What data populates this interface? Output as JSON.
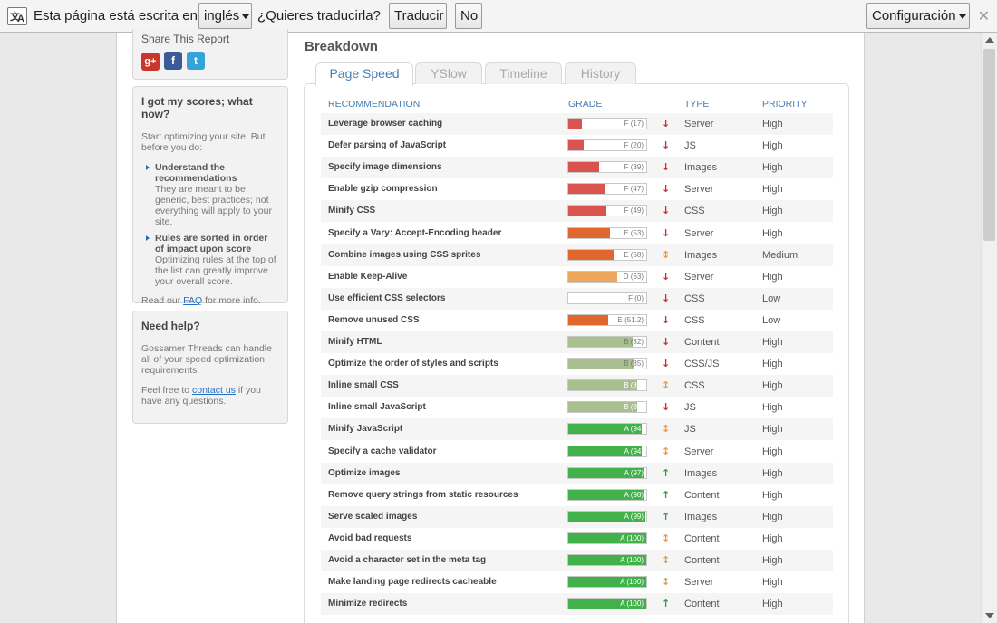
{
  "translate_bar": {
    "message_prefix": "Esta página está escrita en",
    "language": "inglés",
    "question": "¿Quieres traducirla?",
    "translate_label": "Traducir",
    "no_label": "No",
    "settings_label": "Configuración",
    "close_glyph": "✕"
  },
  "sidebar": {
    "share_title": "Share This Report",
    "share_icons": [
      "google-plus-icon",
      "facebook-icon",
      "twitter-icon"
    ],
    "scores": {
      "title": "I got my scores; what now?",
      "intro": "Start optimizing your site! But before you do:",
      "items": [
        {
          "title": "Understand the recommendations",
          "body": "They are meant to be generic, best practices; not everything will apply to your site."
        },
        {
          "title": "Rules are sorted in order of impact upon score",
          "body": "Optimizing rules at the top of the list can greatly improve your overall score."
        }
      ],
      "faq_prefix": "Read our",
      "faq_link": "FAQ",
      "faq_suffix": "for more info."
    },
    "help": {
      "title": "Need help?",
      "body": "Gossamer Threads can handle all of your speed optimization requirements.",
      "contact_prefix": "Feel free to",
      "contact_link": "contact us",
      "contact_suffix": "if you have any questions."
    }
  },
  "main": {
    "title": "Breakdown",
    "tabs": [
      {
        "label": "Page Speed",
        "active": true
      },
      {
        "label": "YSlow",
        "active": false
      },
      {
        "label": "Timeline",
        "active": false
      },
      {
        "label": "History",
        "active": false
      }
    ],
    "columns": {
      "recommendation": "RECOMMENDATION",
      "grade": "GRADE",
      "type": "TYPE",
      "priority": "PRIORITY"
    },
    "colors": {
      "red": "#d9534f",
      "orange": "#e0672e",
      "light_orange": "#eea75a",
      "sage": "#a9c08e",
      "green": "#41b24a",
      "arrow_red": "#c9302c",
      "arrow_orange": "#e89a3c",
      "arrow_green": "#3c9a3c"
    },
    "rows": [
      {
        "name": "Leverage browser caching",
        "grade": "F (17)",
        "score": 17,
        "trend": "down",
        "type": "Server",
        "priority": "High"
      },
      {
        "name": "Defer parsing of JavaScript",
        "grade": "F (20)",
        "score": 20,
        "trend": "down",
        "type": "JS",
        "priority": "High"
      },
      {
        "name": "Specify image dimensions",
        "grade": "F (39)",
        "score": 39,
        "trend": "down",
        "type": "Images",
        "priority": "High"
      },
      {
        "name": "Enable gzip compression",
        "grade": "F (47)",
        "score": 47,
        "trend": "down",
        "type": "Server",
        "priority": "High"
      },
      {
        "name": "Minify CSS",
        "grade": "F (49)",
        "score": 49,
        "trend": "down",
        "type": "CSS",
        "priority": "High"
      },
      {
        "name": "Specify a Vary: Accept-Encoding header",
        "grade": "E (53)",
        "score": 53,
        "trend": "down",
        "type": "Server",
        "priority": "High"
      },
      {
        "name": "Combine images using CSS sprites",
        "grade": "E (58)",
        "score": 58,
        "trend": "both",
        "type": "Images",
        "priority": "Medium"
      },
      {
        "name": "Enable Keep-Alive",
        "grade": "D (63)",
        "score": 63,
        "trend": "down",
        "type": "Server",
        "priority": "High"
      },
      {
        "name": "Use efficient CSS selectors",
        "grade": "F (0)",
        "score": 0,
        "trend": "down",
        "type": "CSS",
        "priority": "Low"
      },
      {
        "name": "Remove unused CSS",
        "grade": "E (51.2)",
        "score": 51.2,
        "trend": "down",
        "type": "CSS",
        "priority": "Low"
      },
      {
        "name": "Minify HTML",
        "grade": "B (82)",
        "score": 82,
        "trend": "down",
        "type": "Content",
        "priority": "High"
      },
      {
        "name": "Optimize the order of styles and scripts",
        "grade": "B (85)",
        "score": 85,
        "trend": "down",
        "type": "CSS/JS",
        "priority": "High"
      },
      {
        "name": "Inline small CSS",
        "grade": "B (88)",
        "score": 88,
        "trend": "both",
        "type": "CSS",
        "priority": "High"
      },
      {
        "name": "Inline small JavaScript",
        "grade": "B (88)",
        "score": 88,
        "trend": "down",
        "type": "JS",
        "priority": "High"
      },
      {
        "name": "Minify JavaScript",
        "grade": "A (94)",
        "score": 94,
        "trend": "both",
        "type": "JS",
        "priority": "High"
      },
      {
        "name": "Specify a cache validator",
        "grade": "A (94)",
        "score": 94,
        "trend": "both",
        "type": "Server",
        "priority": "High"
      },
      {
        "name": "Optimize images",
        "grade": "A (97)",
        "score": 97,
        "trend": "up",
        "type": "Images",
        "priority": "High"
      },
      {
        "name": "Remove query strings from static resources",
        "grade": "A (98)",
        "score": 98,
        "trend": "up",
        "type": "Content",
        "priority": "High"
      },
      {
        "name": "Serve scaled images",
        "grade": "A (99)",
        "score": 99,
        "trend": "up",
        "type": "Images",
        "priority": "High"
      },
      {
        "name": "Avoid bad requests",
        "grade": "A (100)",
        "score": 100,
        "trend": "both",
        "type": "Content",
        "priority": "High"
      },
      {
        "name": "Avoid a character set in the meta tag",
        "grade": "A (100)",
        "score": 100,
        "trend": "both",
        "type": "Content",
        "priority": "High"
      },
      {
        "name": "Make landing page redirects cacheable",
        "grade": "A (100)",
        "score": 100,
        "trend": "both",
        "type": "Server",
        "priority": "High"
      },
      {
        "name": "Minimize redirects",
        "grade": "A (100)",
        "score": 100,
        "trend": "up",
        "type": "Content",
        "priority": "High"
      }
    ]
  }
}
